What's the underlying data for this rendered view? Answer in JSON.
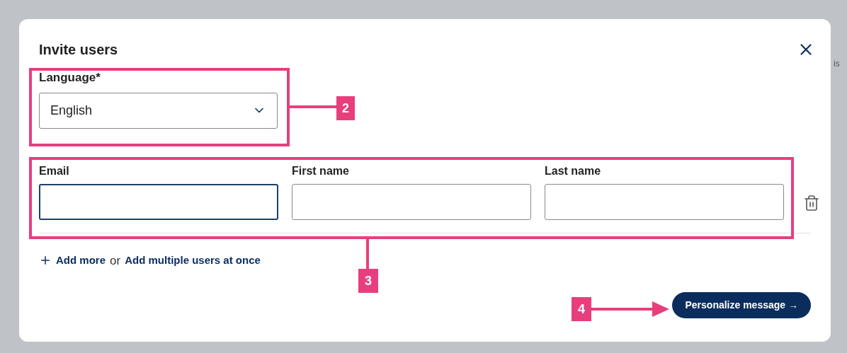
{
  "background_text": "is",
  "dialog": {
    "title": "Invite users",
    "language": {
      "label": "Language*",
      "value": "English"
    },
    "fields": [
      {
        "label": "Email",
        "focused": true
      },
      {
        "label": "First name",
        "focused": false
      },
      {
        "label": "Last name",
        "focused": false
      }
    ],
    "add_more": "Add more",
    "or": "or",
    "add_multiple": "Add multiple users at once",
    "primary_button": "Personalize message →"
  },
  "annotations": [
    {
      "label": "2"
    },
    {
      "label": "3"
    },
    {
      "label": "4"
    }
  ]
}
